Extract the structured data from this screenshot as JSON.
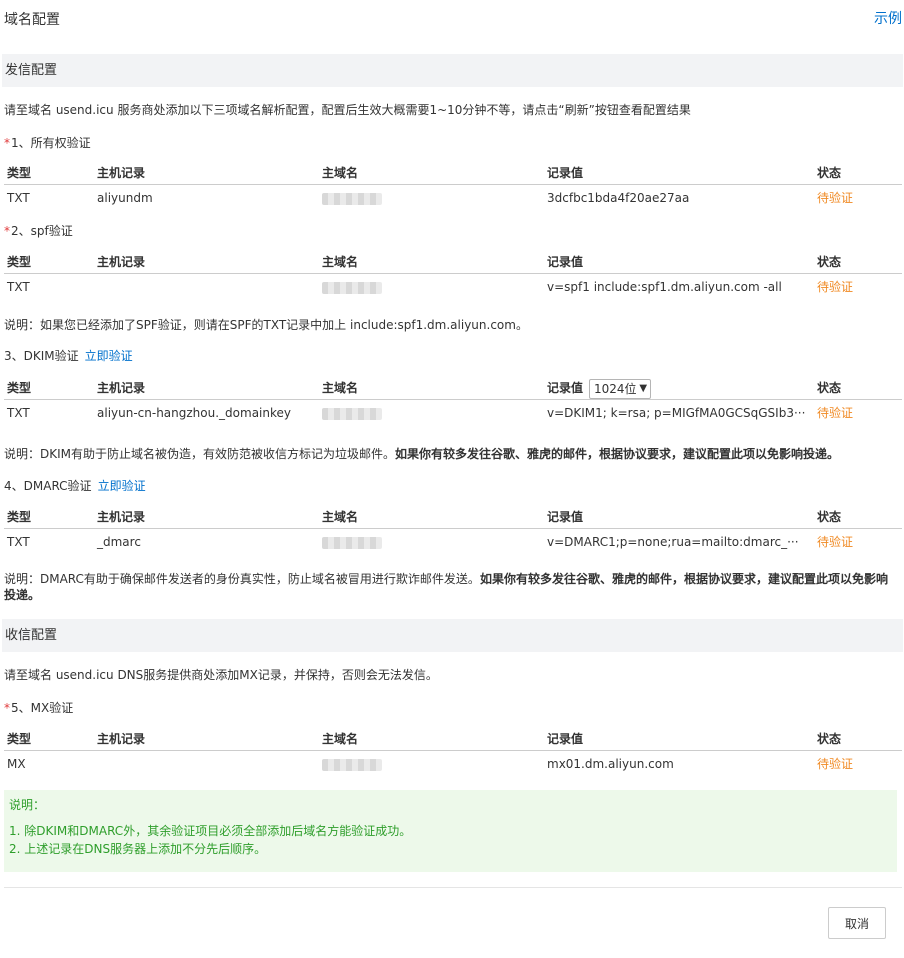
{
  "header": {
    "title": "域名配置",
    "example_link": "示例"
  },
  "send": {
    "section_title": "发信配置",
    "intro": "请至域名 usend.icu 服务商处添加以下三项域名解析配置，配置后生效大概需要1~10分钟不等，请点击“刷新”按钮查看配置结果",
    "columns": [
      "类型",
      "主机记录",
      "主域名",
      "记录值",
      "状态"
    ],
    "ownership": {
      "star": "*",
      "title": "1、所有权验证",
      "row": {
        "type": "TXT",
        "host": "aliyundm",
        "value": "3dcfbc1bda4f20ae27aa",
        "status": "待验证"
      }
    },
    "spf": {
      "star": "*",
      "title": "2、spf验证",
      "row": {
        "type": "TXT",
        "host": "",
        "value": "v=spf1 include:spf1.dm.aliyun.com -all",
        "status": "待验证"
      },
      "note": "说明：如果您已经添加了SPF验证，则请在SPF的TXT记录中加上 include:spf1.dm.aliyun.com。"
    },
    "dkim": {
      "title": "3、DKIM验证",
      "link": "立即验证",
      "select_value": "1024位",
      "row": {
        "type": "TXT",
        "host": "aliyun-cn-hangzhou._domainkey",
        "value": "v=DKIM1; k=rsa; p=MIGfMA0GCSqGSIb3···",
        "status": "待验证"
      },
      "note": "说明：DKIM有助于防止域名被伪造，有效防范被收信方标记为垃圾邮件。",
      "note_bold": "如果你有较多发往谷歌、雅虎的邮件，根据协议要求，建议配置此项以免影响投递。"
    },
    "dmarc": {
      "title": "4、DMARC验证",
      "link": "立即验证",
      "row": {
        "type": "TXT",
        "host": "_dmarc",
        "value": "v=DMARC1;p=none;rua=mailto:dmarc_···",
        "status": "待验证"
      },
      "note": "说明：DMARC有助于确保邮件发送者的身份真实性，防止域名被冒用进行欺诈邮件发送。",
      "note_bold": "如果你有较多发往谷歌、雅虎的邮件，根据协议要求，建议配置此项以免影响投递。"
    }
  },
  "receive": {
    "section_title": "收信配置",
    "intro": "请至域名 usend.icu DNS服务提供商处添加MX记录，并保持，否则会无法发信。",
    "mx": {
      "star": "*",
      "title": "5、MX验证",
      "row": {
        "type": "MX",
        "host": "",
        "value": "mx01.dm.aliyun.com",
        "status": "待验证"
      }
    }
  },
  "note_box": {
    "title": "说明：",
    "items": [
      "1. 除DKIM和DMARC外，其余验证项目必须全部添加后域名方能验证成功。",
      "2. 上述记录在DNS服务器上添加不分先后顺序。"
    ]
  },
  "footer": {
    "cancel_label": "取消"
  }
}
